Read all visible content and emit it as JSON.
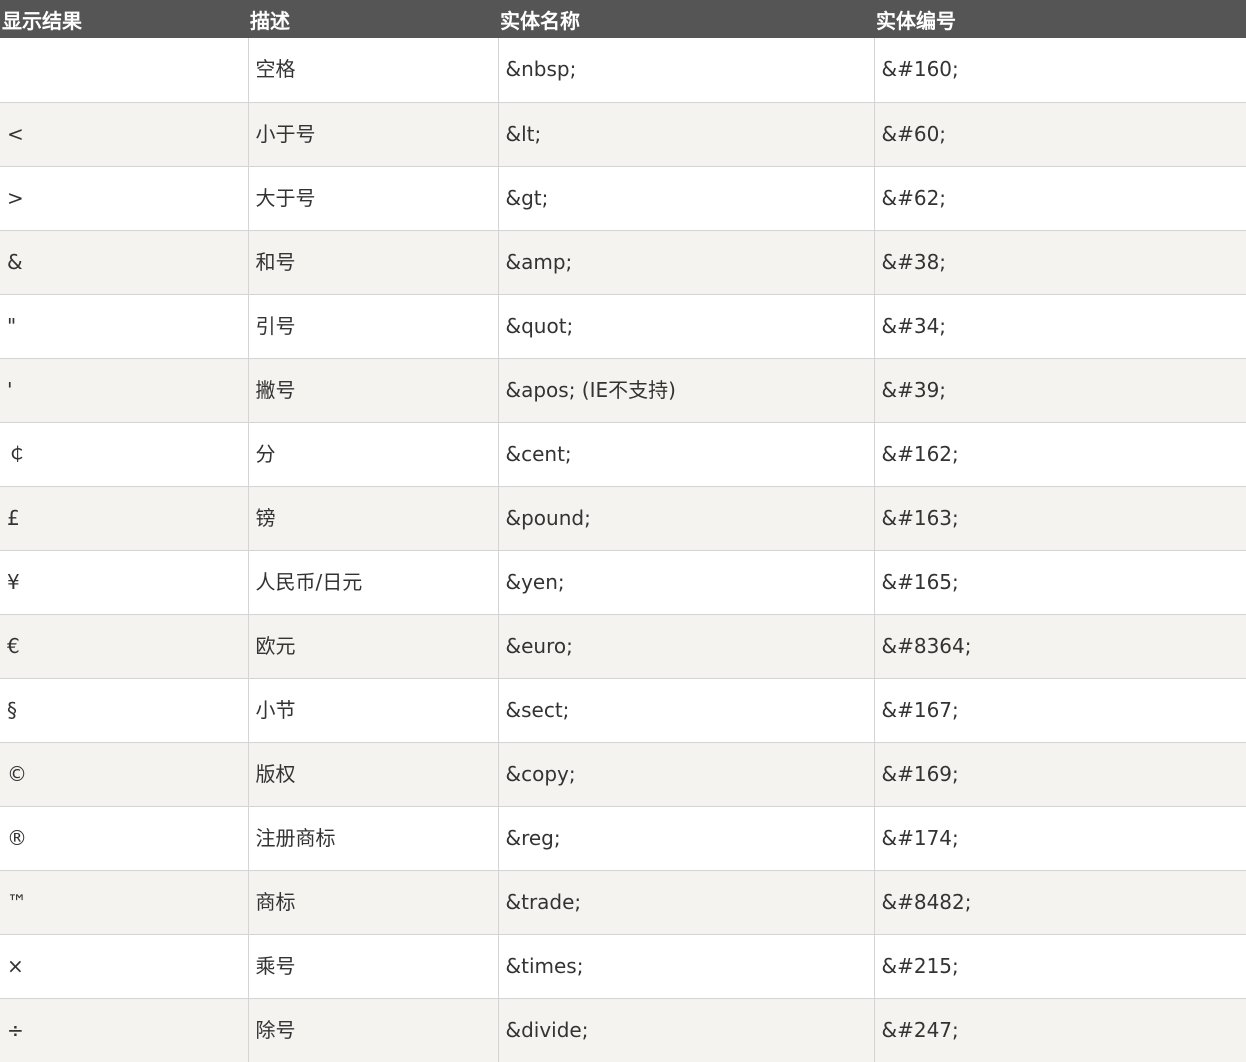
{
  "table": {
    "headers": [
      "显示结果",
      "描述",
      "实体名称",
      "实体编号"
    ],
    "rows": [
      [
        " ",
        "空格",
        "&nbsp;",
        "&#160;"
      ],
      [
        "<",
        "小于号",
        "&lt;",
        "&#60;"
      ],
      [
        ">",
        "大于号",
        "&gt;",
        "&#62;"
      ],
      [
        "&",
        "和号",
        "&amp;",
        "&#38;"
      ],
      [
        "\"",
        "引号",
        "&quot;",
        "&#34;"
      ],
      [
        "'",
        "撇号",
        "&apos; (IE不支持)",
        "&#39;"
      ],
      [
        "￠",
        "分",
        "&cent;",
        "&#162;"
      ],
      [
        "£",
        "镑",
        "&pound;",
        "&#163;"
      ],
      [
        "¥",
        "人民币/日元",
        "&yen;",
        "&#165;"
      ],
      [
        "€",
        "欧元",
        "&euro;",
        "&#8364;"
      ],
      [
        "§",
        "小节",
        "&sect;",
        "&#167;"
      ],
      [
        "©",
        "版权",
        "&copy;",
        "&#169;"
      ],
      [
        "®",
        "注册商标",
        "&reg;",
        "&#174;"
      ],
      [
        "™",
        "商标",
        "&trade;",
        "&#8482;"
      ],
      [
        "×",
        "乘号",
        "&times;",
        "&#215;"
      ],
      [
        "÷",
        "除号",
        "&divide;",
        "&#247;"
      ]
    ]
  }
}
